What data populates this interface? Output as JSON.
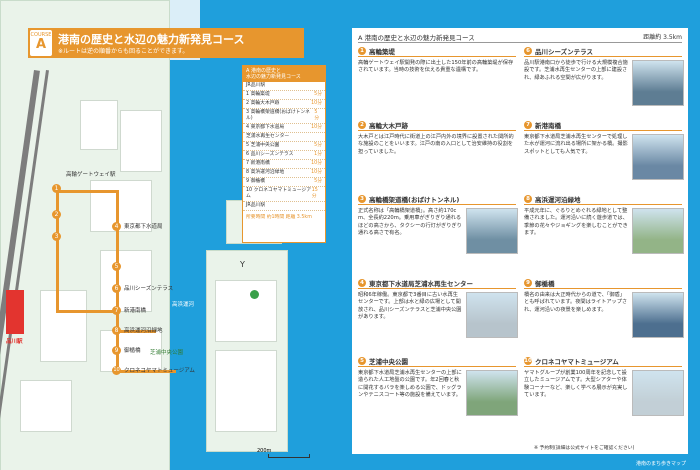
{
  "header": {
    "course_prefix": "COURSE",
    "course_letter": "A",
    "title": "港南の歴史と水辺の魅力新発見コース",
    "note": "※ルートは逆の順番からも回ることができます。"
  },
  "legend": {
    "title_line1": "A  港南の歴史と",
    "title_line2": "水辺の魅力新発見コース",
    "rows": [
      {
        "label": "JR品川駅",
        "time": ""
      },
      {
        "label": "1 高輪築堤",
        "time": "5分"
      },
      {
        "label": "2 高輪大木戸跡",
        "time": "10分"
      },
      {
        "label": "3 高輪橋架道橋(おばけトンネル)",
        "time": "5分"
      },
      {
        "label": "4 東京都下水道局",
        "time": "10分"
      },
      {
        "label": "芝浦水再生センター",
        "time": ""
      },
      {
        "label": "5 芝浦中央公園",
        "time": "5分"
      },
      {
        "label": "6 品川シーズンテラス",
        "time": "1分"
      },
      {
        "label": "7 新港南橋",
        "time": "10分"
      },
      {
        "label": "8 高浜運河沿緑地",
        "time": "10分"
      },
      {
        "label": "9 御楯橋",
        "time": "5分"
      },
      {
        "label": "10 クロネコヤマトミュージアム",
        "time": "15分"
      },
      {
        "label": "JR品川駅",
        "time": ""
      }
    ],
    "total": "所要時間 約1時間  距離 3.5km"
  },
  "map_labels": {
    "station": "品川駅",
    "park": "芝浦中央公園",
    "canal": "高浜運河",
    "label_a": "高輪ゲートウェイ駅",
    "label_b": "東京都下水道局",
    "label_c": "品川シーズンテラス",
    "label_d": "新港南橋",
    "label_e": "御楯橋",
    "label_f": "クロネコヤマトミュージアム",
    "label_g": "高浜運河沿緑地",
    "scale": "200m",
    "legend_y": "Y"
  },
  "right": {
    "heading": "A 港南の歴史と水辺の魅力新発見コース",
    "distance": "距離約 3.5km",
    "items": [
      {
        "no": "1",
        "title": "高輪築堤",
        "text": "高輪ゲートウェイ駅開発の際に出土した150年前の高輪築堤が保存されています。当時の技術を伝える貴重な遺構です。"
      },
      {
        "no": "2",
        "title": "高輪大木戸跡",
        "text": "大木戸とは江戸時代に街道上の江戸内外の境界に設置された関所的な施設のことをいいます。江戸の南の入口として治安維持の役割を担っていました。"
      },
      {
        "no": "3",
        "title": "高輪橋架道橋(おばけトンネル)",
        "text": "正式名称は「高輪橋架道橋」。高さ約170cm、全長約220m。乗用車がぎりぎり通れるほどの高さから、タクシーの行灯がぎりぎり通れる高さで有名。"
      },
      {
        "no": "4",
        "title": "東京都下水道局芝浦水再生センター",
        "text": "昭和6年稼働。東京都で3番目に古い水再生センターです。上部は水と緑の広場として開放され、品川シーズンテラスと芝浦中央公園があります。"
      },
      {
        "no": "5",
        "title": "芝浦中央公園",
        "text": "東京都下水道局芝浦水再生センターの上部に造られた人工地盤の公園です。年2回春と秋に開花するバラを楽しめる公園で、ドッグランやテニスコート等の施設を備えています。"
      },
      {
        "no": "6",
        "title": "品川シーズンテラス",
        "text": "品川駅港南口から徒歩で行ける大規模複合施設です。芝浦水再生センターの上部に建設され、緑あふれる空間が広がります。"
      },
      {
        "no": "7",
        "title": "新港南橋",
        "text": "東京都下水道局芝浦水再生センターで処理した水が運河に流れ出る場所に架かる橋。撮影スポットとしても人気です。"
      },
      {
        "no": "8",
        "title": "高浜運河沿緑地",
        "text": "平成元年に、ぐるりとめぐれる緑地として整備されました。運河沿いに続く遊歩道では、季節の花々やジョギングを楽しむことができます。"
      },
      {
        "no": "9",
        "title": "御楯橋",
        "text": "橋名の由来は大正時代からの道で、「御盾」とも呼ばれています。夜間はライトアップされ、運河沿いの夜景を楽しめます。"
      },
      {
        "no": "10",
        "title": "クロネコヤマトミュージアム",
        "text": "ヤマトグループが創業100周年を記念して設立したミュージアムです。大型シアターや体験コーナーなど、楽しく学べる展示が充実しています。"
      }
    ],
    "photo_caption": "※ 予約制(詳細は公式サイトをご確認ください)",
    "footer": "港南のまち歩きマップ"
  },
  "colors": {
    "accent": "#e7962e",
    "sea": "#1f9fdc",
    "land": "#eaf3ea",
    "station": "#e3342f"
  }
}
